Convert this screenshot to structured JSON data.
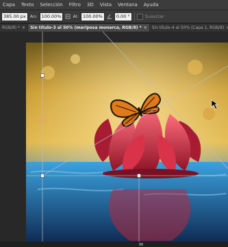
{
  "menu": [
    "Capa",
    "Texto",
    "Selección",
    "Filtro",
    "3D",
    "Vista",
    "Ventana",
    "Ayuda"
  ],
  "options": {
    "x_value": "385.00 px",
    "w_label": "An:",
    "w_value": "100.00%",
    "h_label": "Al:",
    "h_value": "100.00%",
    "angle_value": "0.00",
    "angle_unit": "°",
    "smooth_label": "Suavizar"
  },
  "tabs": [
    {
      "label": "RGB/8) *",
      "active": false
    },
    {
      "label": "Sin título-3 al 50% (mariposa monarca, RGB/8) *",
      "active": true
    },
    {
      "label": "Sin título-4 al 50% (Capa 1, RGB/8)",
      "active": false
    }
  ],
  "icons": {
    "swap": "swap-icon",
    "angle": "angle-icon",
    "close": "close-icon",
    "cursor": "cursor-icon"
  },
  "colors": {
    "menubar": "#3c3c3c",
    "optbar": "#3a3a3a",
    "tab_active": "#4a4a4a",
    "flower": "#c72b3d",
    "water": "#2f86c2"
  }
}
